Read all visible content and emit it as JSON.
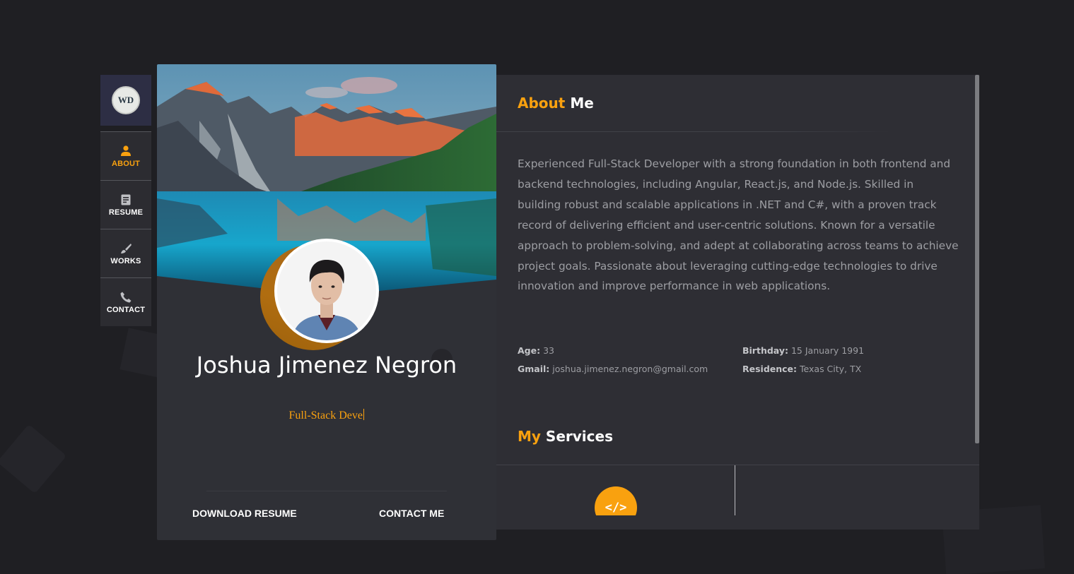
{
  "nav": {
    "logo_text": "WD",
    "items": [
      {
        "label": "ABOUT",
        "icon": "person-icon",
        "active": true
      },
      {
        "label": "RESUME",
        "icon": "document-icon",
        "active": false
      },
      {
        "label": "WORKS",
        "icon": "brush-icon",
        "active": false
      },
      {
        "label": "CONTACT",
        "icon": "phone-icon",
        "active": false
      }
    ]
  },
  "profile": {
    "name": "Joshua Jimenez Negron",
    "role_typed": "Full-Stack Deve",
    "download_label": "DOWNLOAD RESUME",
    "contact_label": "CONTACT ME"
  },
  "about": {
    "title_accent": "About",
    "title_rest": "Me",
    "text": "Experienced Full-Stack Developer with a strong foundation in both frontend and backend technologies, including Angular, React.js, and Node.js. Skilled in building robust and scalable applications in .NET and C#, with a proven track record of delivering efficient and user-centric solutions. Known for a versatile approach to problem-solving, and adept at collaborating across teams to achieve project goals. Passionate about leveraging cutting-edge technologies to drive innovation and improve performance in web applications.",
    "age_label": "Age:",
    "age_value": "33",
    "birthday_label": "Birthday:",
    "birthday_value": "15 January 1991",
    "gmail_label": "Gmail:",
    "gmail_value": "joshua.jimenez.negron@gmail.com",
    "residence_label": "Residence:",
    "residence_value": "Texas City, TX"
  },
  "services": {
    "title_accent": "My",
    "title_rest": "Services",
    "icon_glyph": "</>"
  },
  "colors": {
    "accent": "#f9a10f",
    "background": "#1f1f23",
    "panel": "#2e2e34"
  }
}
